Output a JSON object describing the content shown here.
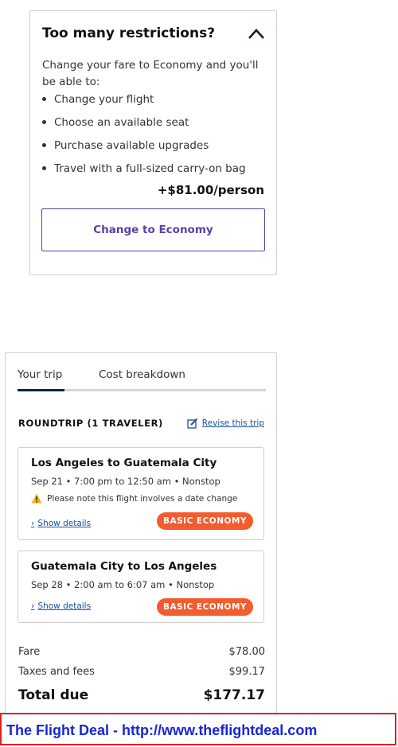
{
  "restrictions": {
    "title": "Too many restrictions?",
    "description": "Change your fare to Economy and you'll be able to:",
    "benefits": [
      "Change your flight",
      "Choose an available seat",
      "Purchase available upgrades",
      "Travel with a full-sized carry-on bag"
    ],
    "price": "+$81.00/person",
    "button_label": "Change to Economy"
  },
  "trip": {
    "tabs": [
      "Your trip",
      "Cost breakdown"
    ],
    "active_tab": "Your trip",
    "heading": "ROUNDTRIP (1 TRAVELER)",
    "revise_label": "Revise this trip",
    "flights": [
      {
        "route": "Los Angeles to Guatemala City",
        "time": "Sep 21 • 7:00 pm to 12:50 am • Nonstop",
        "note": "Please note this flight involves a date change",
        "show_details": "Show details",
        "badge": "BASIC ECONOMY"
      },
      {
        "route": "Guatemala City to Los Angeles",
        "time": "Sep 28 • 2:00 am to 6:07 am • Nonstop",
        "show_details": "Show details",
        "badge": "BASIC ECONOMY"
      }
    ],
    "costs": {
      "fare_label": "Fare",
      "fare_value": "$78.00",
      "taxes_label": "Taxes and fees",
      "taxes_value": "$99.17",
      "total_label": "Total due",
      "total_value": "$177.17"
    }
  },
  "watermark": "The Flight Deal - http://www.theflightdeal.com",
  "colors": {
    "accent_purple": "#5b3ea6",
    "badge_orange": "#f25c2e",
    "link_blue": "#1a4fa0",
    "tab_active": "#0c2340",
    "watermark_blue": "#1726d6",
    "watermark_border": "#e02020"
  }
}
